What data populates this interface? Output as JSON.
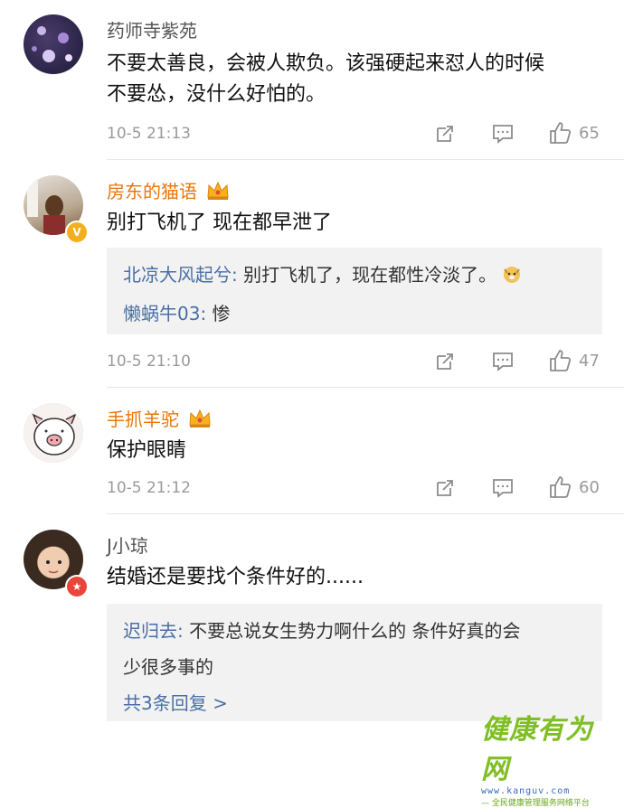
{
  "comments": [
    {
      "name": "药师寺紫苑",
      "text_lines": [
        "不要太善良，会被人欺负。该强硬起来怼人的时候",
        "不要怂，没什么好怕的。"
      ],
      "time": "10-5 21:13",
      "likes": "65"
    },
    {
      "name": "房东的猫语",
      "text_lines": [
        "别打飞机了 现在都早泄了"
      ],
      "replies": [
        {
          "name": "北凉大风起兮:",
          "text": " 别打飞机了，现在都性冷淡了。"
        },
        {
          "name": "懒蜗牛03:",
          "text": " 惨"
        }
      ],
      "time": "10-5 21:10",
      "likes": "47"
    },
    {
      "name": "手抓羊驼",
      "text_lines": [
        "保护眼睛"
      ],
      "time": "10-5 21:12",
      "likes": "60"
    },
    {
      "name": "J小琼",
      "text_lines": [
        "结婚还是要找个条件好的......"
      ],
      "replies": [
        {
          "name": "迟归去:",
          "text": " 不要总说女生势力啊什么的 条件好真的会"
        },
        {
          "name": "",
          "text": "少很多事的"
        }
      ],
      "more_replies": "共3条回复 >"
    }
  ],
  "icons": {
    "repost": "repost-icon",
    "comment": "comment-icon",
    "like": "thumbs-up-icon",
    "crown": "vip-crown-icon",
    "verified": "verified-badge-icon"
  },
  "colors": {
    "reply_name": "#4a6fa5",
    "vip_name": "#e8760a",
    "meta": "#9a9a9a",
    "reply_bg": "#f2f2f2"
  },
  "watermark": {
    "title": "健康有为网",
    "url": "www.kanguv.com",
    "subtitle": "— 全民健康管理服务网络平台"
  }
}
